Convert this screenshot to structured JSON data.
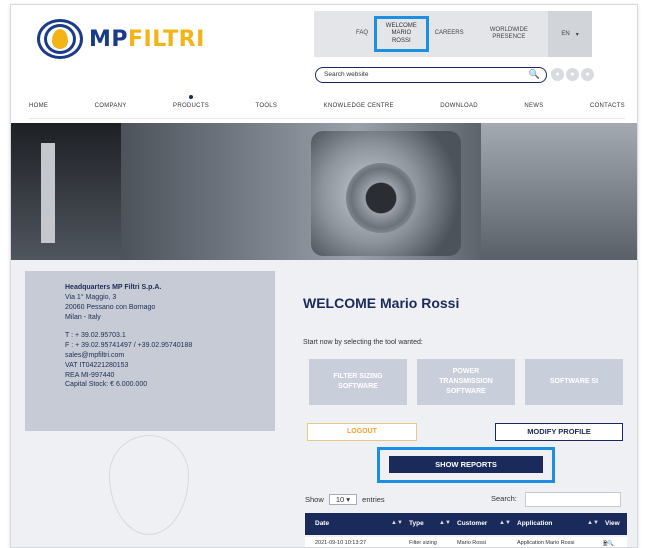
{
  "header": {
    "logo_mp": "MP",
    "logo_filtri": "FILTRI",
    "topbar": {
      "faq": "FAQ",
      "welcome_line1": "WELCOME",
      "welcome_line2": "MARIO ROSSI",
      "careers": "CAREERS",
      "worldwide": "WORLDWIDE PRESENCE",
      "lang": "EN",
      "lang_caret": "▾"
    },
    "search_placeholder": "Search website",
    "search_icon": "magnifier-icon",
    "social_icons": [
      "social-icon",
      "social-icon",
      "social-icon"
    ]
  },
  "nav": {
    "items": [
      "HOME",
      "COMPANY",
      "PRODUCTS",
      "TOOLS",
      "KNOWLEDGE CENTRE",
      "DOWNLOAD",
      "NEWS",
      "CONTACTS"
    ],
    "active": "PRODUCTS"
  },
  "hq": {
    "name": "Headquarters MP Filtri S.p.A.",
    "street": "Via 1° Maggio, 3",
    "city": "20060 Pessano con Bornago",
    "region": "Milan - Italy",
    "tel": "T : + 39.02.95703.1",
    "fax": "F : + 39.02.95741497 / +39.02.95740188",
    "email": "sales@mpfiltri.com",
    "vat": "VAT IT04221280153",
    "rea": "REA MI-997440",
    "capital": "Capital Stock: € 6.000.000"
  },
  "main": {
    "welcome_label": "WELCOME",
    "user_name": "Mario Rossi",
    "hint": "Start now by selecting the tool wanted:",
    "tools": {
      "filter_sizing": [
        "FILTER SIZING",
        "SOFTWARE"
      ],
      "power_transmission": [
        "POWER",
        "TRANSMISSION",
        "SOFTWARE"
      ],
      "software_si": [
        "SOFTWARE SI"
      ]
    },
    "logout": "LOGOUT",
    "modify_profile": "MODIFY PROFILE",
    "show_reports": "SHOW REPORTS"
  },
  "table": {
    "show_label": "Show",
    "entries_value": "10",
    "entries_label": "entries",
    "search_label": "Search:",
    "headers": [
      "Date",
      "Type",
      "Customer",
      "Application",
      "View"
    ],
    "rows": [
      {
        "date": "2021-09-10 10:13:27",
        "type": "Filter sizing",
        "customer": "Mario Rossi",
        "application": "Application Mario Rossi",
        "view": "🗎🔍"
      }
    ]
  },
  "colors": {
    "navy": "#1a2a5a",
    "highlight": "#1c8fe0",
    "logo_yellow": "#f2b416",
    "logout_orange": "#f0a23a"
  }
}
